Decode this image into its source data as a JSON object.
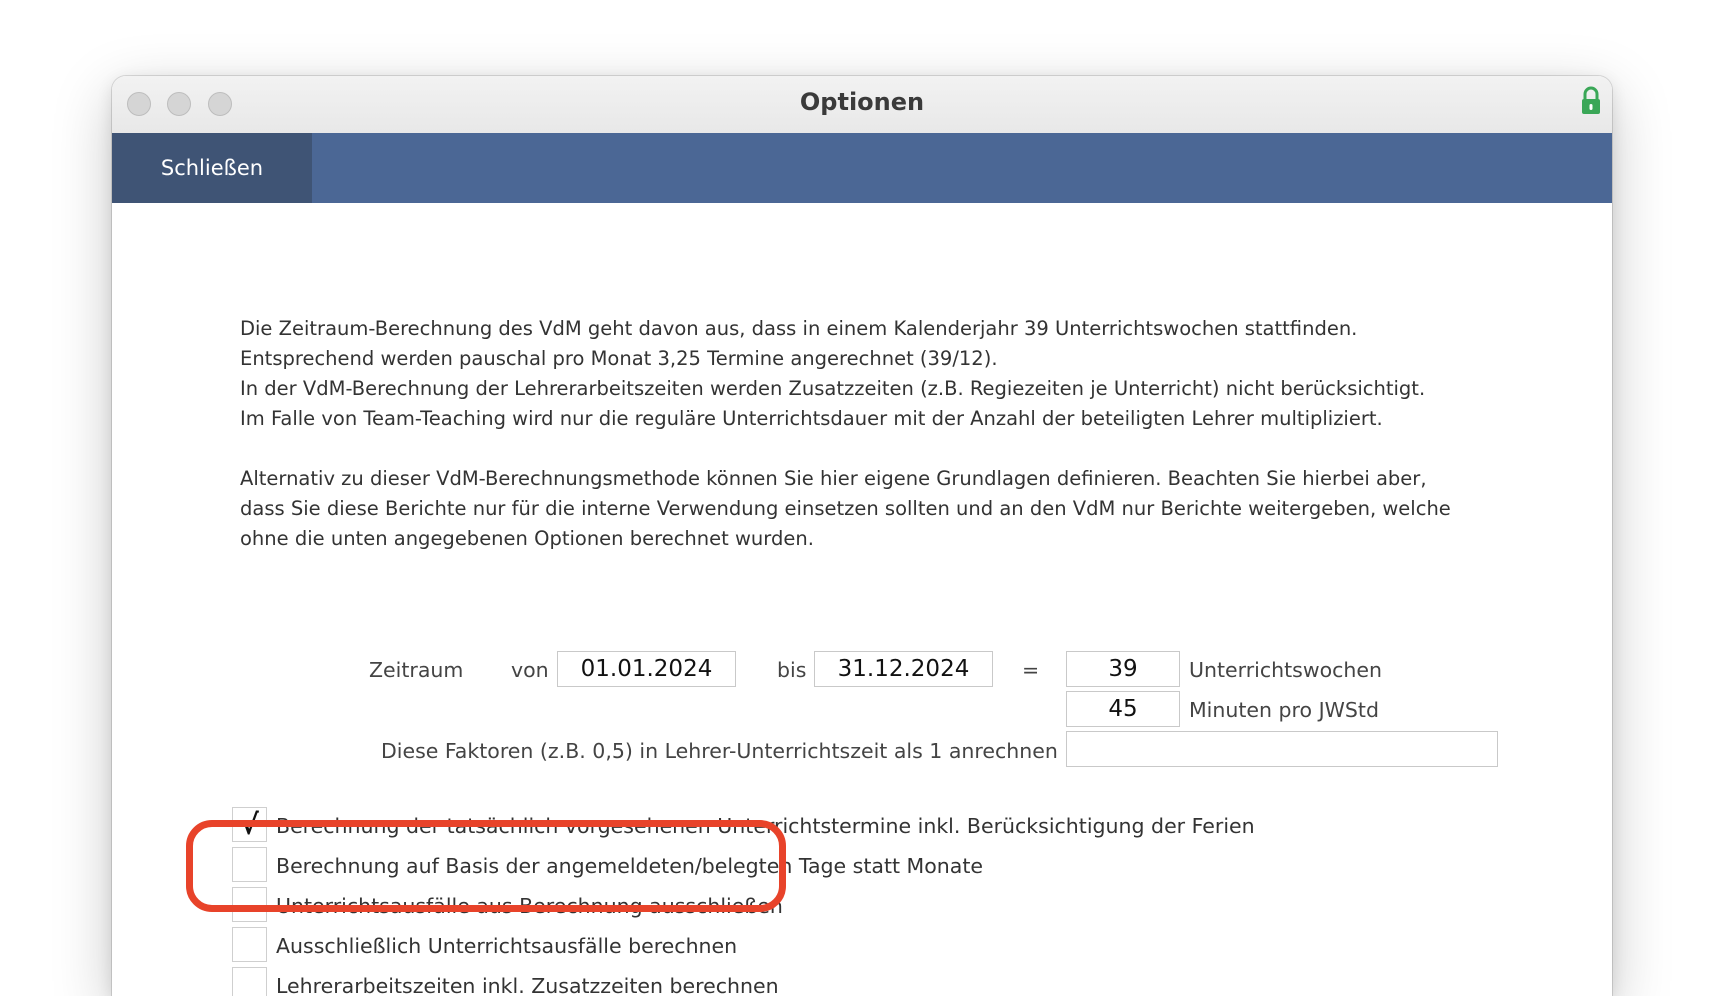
{
  "window": {
    "title": "Optionen",
    "lock_icon": "lock-icon",
    "lock_color": "#3aa757"
  },
  "toolbar": {
    "close_label": "Schließen",
    "bar_color": "#4b6795"
  },
  "info": {
    "paragraph1": [
      "Die Zeitraum-Berechnung des VdM geht davon aus, dass in einem Kalenderjahr 39 Unterrichtswochen stattfinden.",
      "Entsprechend werden pauschal pro Monat 3,25 Termine angerechnet (39/12).",
      "In der VdM-Berechnung der Lehrerarbeitszeiten werden Zusatzzeiten (z.B. Regiezeiten je Unterricht) nicht berücksichtigt.",
      "Im Falle von Team-Teaching wird nur die reguläre Unterrichtsdauer mit der Anzahl der beteiligten Lehrer multipliziert."
    ],
    "paragraph2": [
      "Alternativ zu dieser VdM-Berechnungsmethode können Sie hier eigene Grundlagen definieren. Beachten Sie hierbei aber,",
      "dass Sie diese Berichte nur für die interne Verwendung einsetzen sollten und an den VdM nur Berichte weitergeben, welche",
      "ohne die unten angegebenen Optionen berechnet wurden."
    ]
  },
  "period": {
    "label": "Zeitraum",
    "from_label": "von",
    "from_value": "01.01.2024",
    "to_label": "bis",
    "to_value": "31.12.2024",
    "equals": "=",
    "weeks_value": "39",
    "weeks_label": "Unterrichtswochen",
    "minutes_value": "45",
    "minutes_label": "Minuten pro JWStd",
    "factors_label": "Diese Faktoren (z.B. 0,5) in Lehrer-Unterrichtszeit als 1 anrechnen",
    "factors_value": ""
  },
  "options": [
    {
      "label": "Berechnung der tatsächlich vorgesehenen Unterrichtstermine inkl. Berücksichtigung der Ferien",
      "checked": true
    },
    {
      "label": "Berechnung auf Basis der angemeldeten/belegten Tage statt Monate",
      "checked": false
    },
    {
      "label": "Unterrichtsausfälle aus Berechnung ausschließen",
      "checked": false
    },
    {
      "label": "Ausschließlich Unterrichtsausfälle berechnen",
      "checked": false
    },
    {
      "label": "Lehrerarbeitszeiten inkl. Zusatzzeiten berechnen",
      "checked": false
    }
  ],
  "check_mark": "√",
  "highlight_color": "#e8432a"
}
